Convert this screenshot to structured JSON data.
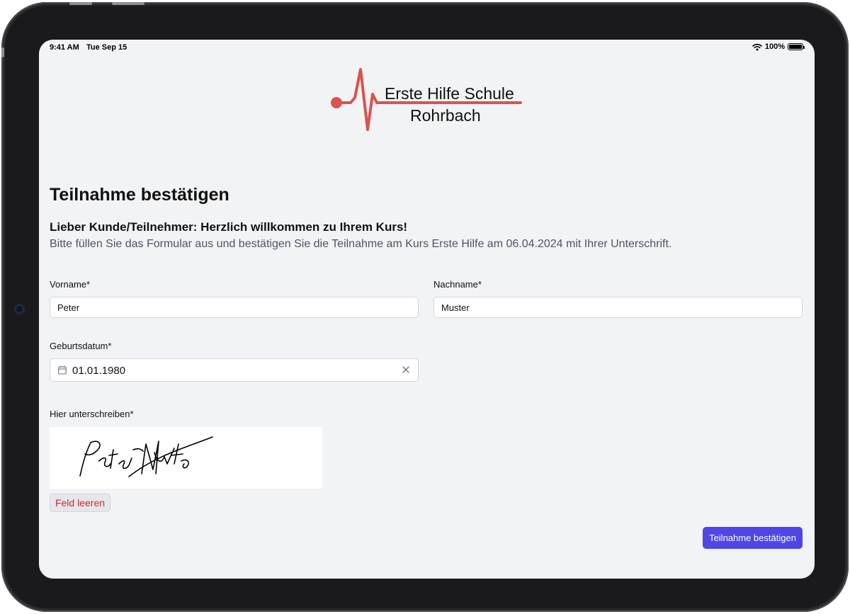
{
  "status_bar": {
    "time": "9:41 AM",
    "date": "Tue Sep 15",
    "battery": "100%",
    "icons": [
      "wifi-icon",
      "battery-icon"
    ]
  },
  "logo": {
    "line1": "Erste Hilfe Schule",
    "line2": "Rohrbach",
    "accent_color": "#d9534f"
  },
  "page": {
    "title": "Teilnahme bestätigen",
    "welcome": "Lieber Kunde/Teilnehmer: Herzlich willkommen zu Ihrem Kurs!",
    "intro": "Bitte füllen Sie das Formular aus und bestätigen Sie die Teilnahme am Kurs Erste Hilfe am 06.04.2024 mit Ihrer Unterschrift."
  },
  "form": {
    "firstname": {
      "label": "Vorname*",
      "value": "Peter"
    },
    "lastname": {
      "label": "Nachname*",
      "value": "Muster"
    },
    "birthdate": {
      "label": "Geburtsdatum*",
      "value": "01.01.1980",
      "icon": "calendar-icon",
      "clear_icon": "close-icon"
    },
    "signature": {
      "label": "Hier unterschreiben*",
      "clear_label": "Feld leeren"
    },
    "submit_label": "Teilnahme bestätigen"
  },
  "colors": {
    "background": "#f2f3f5",
    "primary": "#4f46e5",
    "danger": "#dc2626"
  }
}
